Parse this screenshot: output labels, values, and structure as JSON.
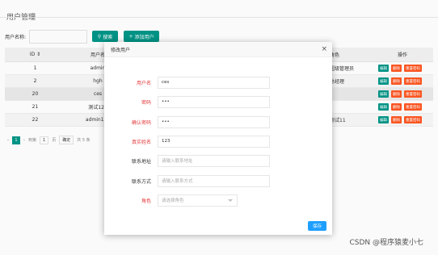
{
  "page": {
    "title": "用户管理"
  },
  "search": {
    "label": "用户名称:",
    "value": "",
    "search_button": "搜索",
    "add_button": "添加用户"
  },
  "table": {
    "headers": {
      "id": "ID",
      "name": "用户名",
      "role": "角色",
      "ops": "操作"
    },
    "rows": [
      {
        "id": "1",
        "name": "admin",
        "role": "超级管理员"
      },
      {
        "id": "2",
        "name": "hgh",
        "role": "总经理"
      },
      {
        "id": "20",
        "name": "ces",
        "role": ""
      },
      {
        "id": "21",
        "name": "测试123",
        "role": ""
      },
      {
        "id": "22",
        "name": "admin123",
        "role": "测试11"
      }
    ],
    "op_labels": {
      "edit": "编辑",
      "delete": "删除",
      "reset": "重置密码"
    }
  },
  "pager": {
    "page": "1",
    "goto_label": "到第",
    "page_value": "1",
    "page_unit": "页",
    "confirm": "确定",
    "total": "共 5 条"
  },
  "modal": {
    "title": "修改用户",
    "fields": [
      {
        "label": "用户名",
        "value": "ces",
        "required": true
      },
      {
        "label": "密码",
        "value": "•••",
        "required": true
      },
      {
        "label": "确认密码",
        "value": "•••",
        "required": true
      },
      {
        "label": "真实姓名",
        "value": "123",
        "required": true
      },
      {
        "label": "联系地址",
        "placeholder": "请输入联系地址",
        "required": false
      },
      {
        "label": "联系方式",
        "placeholder": "请输入联系方式",
        "required": false
      }
    ],
    "role": {
      "label": "角色",
      "placeholder": "请选择角色"
    },
    "save_button": "保存"
  },
  "watermark": "CSDN @程序猿麦小七",
  "colors": {
    "primary": "#009688",
    "danger": "#ff5722",
    "blue": "#1e9fff"
  }
}
